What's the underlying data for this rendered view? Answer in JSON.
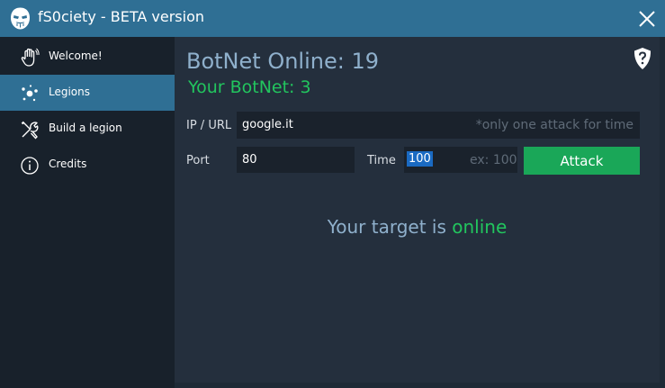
{
  "window": {
    "title": "fS0ciety - BETA version",
    "close_icon": "close-icon",
    "app_icon": "mask-icon"
  },
  "sidebar": {
    "items": [
      {
        "label": "Welcome!",
        "icon": "hand-wave-icon",
        "active": false
      },
      {
        "label": "Legions",
        "icon": "dots-icon",
        "active": true
      },
      {
        "label": "Build a legion",
        "icon": "tools-icon",
        "active": false
      },
      {
        "label": "Credits",
        "icon": "info-icon",
        "active": false
      }
    ]
  },
  "main": {
    "botnet_online": "BotNet Online: 19",
    "your_botnet": "Your BotNet: 3",
    "help_icon": "shield-question-icon",
    "url_label": "IP / URL",
    "url_value": "google.it",
    "url_hint": "*only one attack for time",
    "port_label": "Port",
    "port_value": "80",
    "time_label": "Time",
    "time_value": "100",
    "time_hint": "ex: 100",
    "attack_label": "Attack",
    "target_prefix": "Your target is",
    "target_status": "online"
  },
  "colors": {
    "titlebar": "#2f6f94",
    "sidebar": "#18212b",
    "content": "#242f3d",
    "accent_green": "#22c55e",
    "attack_button": "#1aa758",
    "text_blue": "#8fb0cc"
  }
}
